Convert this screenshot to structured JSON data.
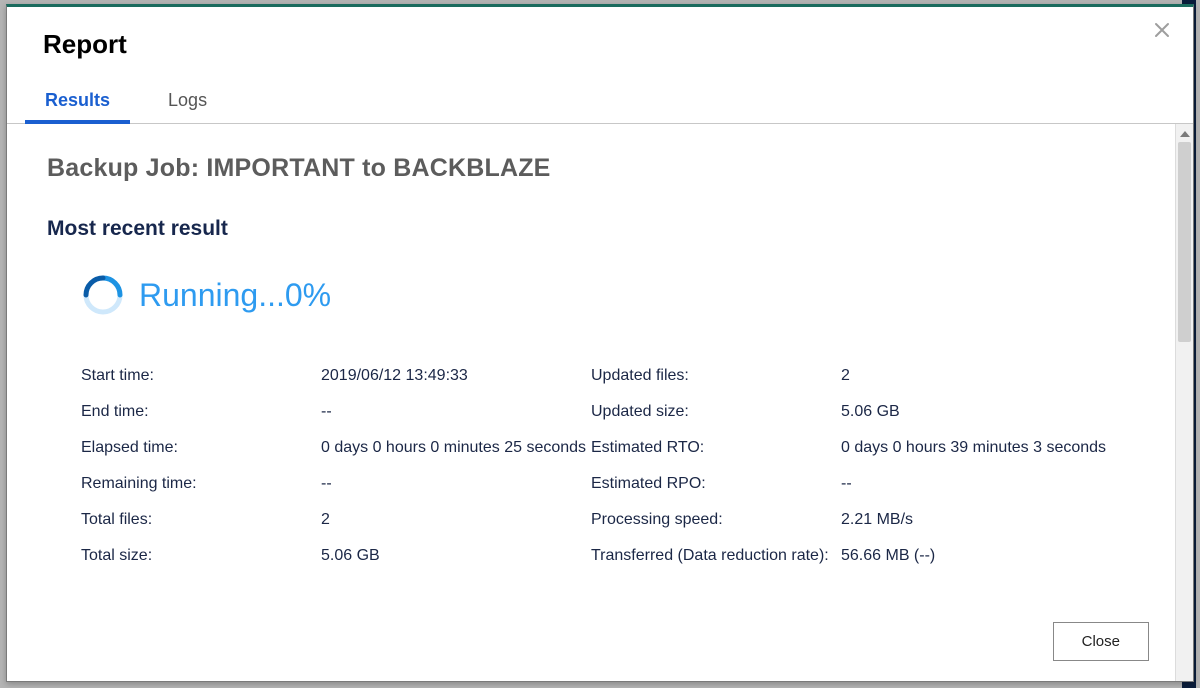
{
  "modal": {
    "title": "Report",
    "tabs": {
      "results": "Results",
      "logs": "Logs"
    },
    "job_label": "Backup Job:",
    "job_name": "IMPORTANT to BACKBLAZE",
    "section": "Most recent result",
    "status": "Running...0%",
    "close_button": "Close"
  },
  "labels": {
    "start_time": "Start time:",
    "end_time": "End time:",
    "elapsed_time": "Elapsed time:",
    "remaining_time": "Remaining time:",
    "total_files": "Total files:",
    "total_size": "Total size:",
    "updated_files": "Updated files:",
    "updated_size": "Updated size:",
    "estimated_rto": "Estimated RTO:",
    "estimated_rpo": "Estimated RPO:",
    "processing_speed": "Processing speed:",
    "transferred": "Transferred (Data reduction rate):"
  },
  "values": {
    "start_time": "2019/06/12 13:49:33",
    "end_time": "--",
    "elapsed_time": "0 days 0 hours 0 minutes 25 seconds",
    "remaining_time": "--",
    "total_files": "2",
    "total_size": "5.06 GB",
    "updated_files": "2",
    "updated_size": "5.06 GB",
    "estimated_rto": "0 days 0 hours 39 minutes 3 seconds",
    "estimated_rpo": "--",
    "processing_speed": "2.21 MB/s",
    "transferred": "56.66 MB (--)"
  }
}
